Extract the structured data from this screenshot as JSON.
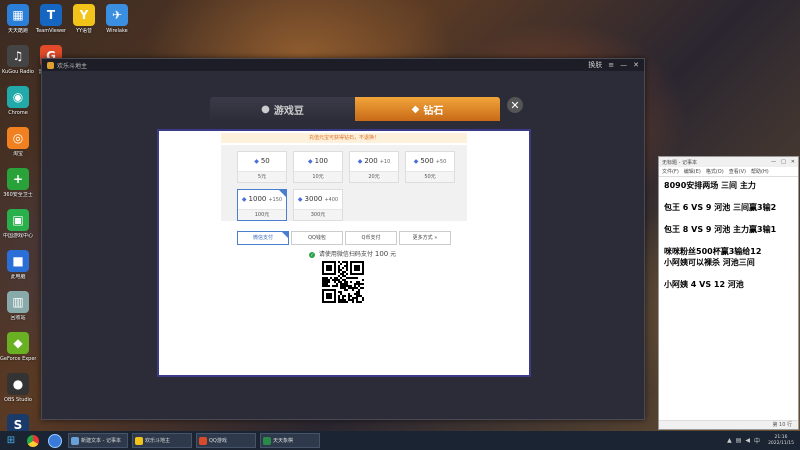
{
  "desktop_icons": [
    {
      "label": "天天酷跑",
      "color": "#2b7fd8",
      "glyph": "▦"
    },
    {
      "label": "TeamViewer",
      "color": "#1566c0",
      "glyph": "T"
    },
    {
      "label": "YY语音",
      "color": "#f2c318",
      "glyph": "Y"
    },
    {
      "label": "Wirelake",
      "color": "#3a8fe0",
      "glyph": "✈"
    },
    {
      "label": "KuGou Radio",
      "color": "#444",
      "glyph": "♫"
    },
    {
      "label": "Chrome",
      "color": "#2aa",
      "glyph": "◉"
    },
    {
      "label": "雷神加速器",
      "color": "#e24a2a",
      "glyph": "G"
    },
    {
      "label": "淘宝",
      "color": "#f08020",
      "glyph": "◎"
    },
    {
      "label": "360安全卫士",
      "color": "#2aa23a",
      "glyph": "+"
    },
    {
      "label": "中国游戏中心",
      "color": "#2ab04a",
      "glyph": "▣"
    },
    {
      "label": "此电脑",
      "color": "#2a6ed8",
      "glyph": "■"
    },
    {
      "label": "回收站",
      "color": "#8aa",
      "glyph": "▥"
    },
    {
      "label": "GeForce Experience",
      "color": "#6ab023",
      "glyph": "◆"
    },
    {
      "label": "OBS Studio",
      "color": "#333",
      "glyph": "●"
    },
    {
      "label": "Steam",
      "color": "#1a3a6a",
      "glyph": "S"
    }
  ],
  "app_window": {
    "title": "欢乐斗地主",
    "controls": {
      "skin": "换肤",
      "menu": "≡",
      "minimize": "—",
      "close": "✕"
    }
  },
  "tabs": {
    "beans": {
      "label": "游戏豆",
      "icon": "bean-icon"
    },
    "diamond": {
      "label": "钻石",
      "icon": "diamond-icon",
      "active": true
    },
    "close": "✕"
  },
  "notice": "充值元宝可获得钻石，不退换！",
  "packages": [
    {
      "amount": "50",
      "bonus": "",
      "price": "5元",
      "selected": false
    },
    {
      "amount": "100",
      "bonus": "",
      "price": "10元",
      "selected": false
    },
    {
      "amount": "200",
      "bonus": "+10",
      "price": "20元",
      "selected": false
    },
    {
      "amount": "500",
      "bonus": "+50",
      "price": "50元",
      "selected": false
    },
    {
      "amount": "1000",
      "bonus": "+150",
      "price": "100元",
      "selected": true
    },
    {
      "amount": "3000",
      "bonus": "+400",
      "price": "300元",
      "selected": false
    }
  ],
  "payment_methods": [
    {
      "label": "微信支付",
      "active": true
    },
    {
      "label": "QQ钱包",
      "active": false
    },
    {
      "label": "Q币支付",
      "active": false
    },
    {
      "label": "更多方式 »",
      "active": false
    }
  ],
  "pay_status": {
    "label": "请使用微信扫码支付",
    "amount": "100",
    "unit": "元"
  },
  "notepad": {
    "title": "无标题 - 记事本",
    "menu": [
      "文件(F)",
      "编辑(E)",
      "格式(O)",
      "查看(V)",
      "帮助(H)"
    ],
    "lines": [
      "8090安排两场 三间 主力",
      "",
      "包王 6 VS 9 河池 三间赢3输2",
      "",
      "包王 8 VS 9 河池 主力赢3输1",
      "",
      "咪咪粉丝500杯赢3输给12",
      "小阿姨可以裸杀 河池三间",
      "",
      "小阿姨 4 VS 12 河池"
    ],
    "status": "第 10 行"
  },
  "taskbar": {
    "tasks": [
      {
        "label": "新建文本 - 记事本",
        "color": "#6aa0d8"
      },
      {
        "label": "欢乐斗地主",
        "color": "#f2c318"
      },
      {
        "label": "QQ游戏",
        "color": "#d84a2a"
      },
      {
        "label": "天天象棋",
        "color": "#2a8a4a"
      }
    ],
    "time": "21:16",
    "date": "2022/11/15"
  }
}
